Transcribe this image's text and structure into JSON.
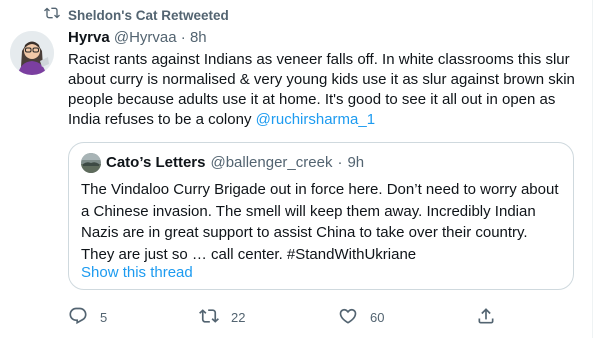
{
  "retweet_label": "Sheldon's Cat Retweeted",
  "tweet": {
    "name": "Hyrva",
    "handle": "@Hyrvaa",
    "separator": "·",
    "time": "8h",
    "text_main": "Racist rants against Indians as veneer falls off. In white classrooms this slur about curry is normalised & very young kids use it as slur against brown skin people because adults use it at home. It's good to see it all out in open as India refuses to be a colony ",
    "mention": "@ruchirsharma_1"
  },
  "quoted": {
    "name": "Cato’s Letters",
    "handle": "@ballenger_creek",
    "separator": "·",
    "time": "9h",
    "text": "The Vindaloo Curry Brigade out in force here. Don’t need to worry about a Chinese invasion. The smell will keep them away. Incredibly Indian Nazis are in great support to assist China to take over their country. They are just so … call center. #StandWithUkriane",
    "show_thread": "Show this thread"
  },
  "actions": {
    "reply_count": "5",
    "retweet_count": "22",
    "like_count": "60"
  },
  "colors": {
    "link": "#1d9bf0",
    "secondary": "#536471",
    "border": "#cfd9de"
  },
  "icons": [
    "retweet-icon",
    "reply-icon",
    "like-icon",
    "share-icon"
  ]
}
